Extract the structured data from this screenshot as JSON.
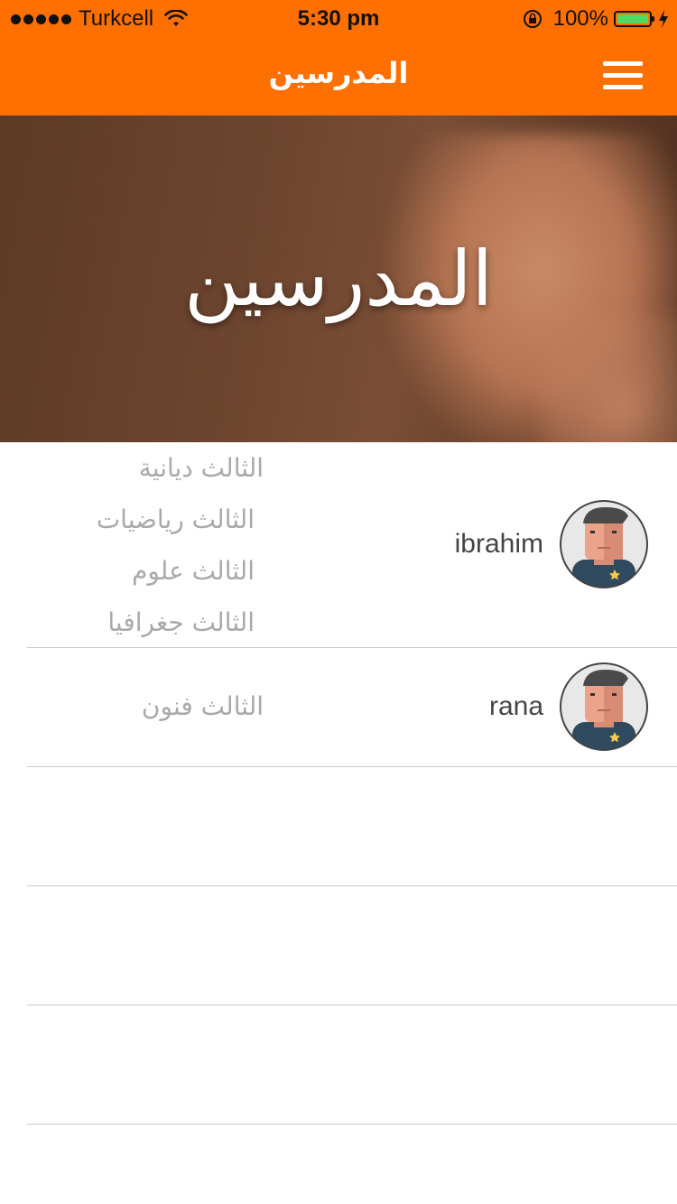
{
  "status_bar": {
    "carrier": "Turkcell",
    "time": "5:30 pm",
    "battery_percent": "100%",
    "battery_level": 1.0
  },
  "nav": {
    "title": "المدرسين",
    "menu_icon": "hamburger-menu-icon"
  },
  "hero": {
    "title": "المدرسين"
  },
  "teachers": [
    {
      "name": "ibrahim",
      "classes": [
        "الثالث ديانية",
        "الثالث رياضيات",
        "الثالث علوم",
        "الثالث جغرافيا"
      ]
    },
    {
      "name": "rana",
      "classes": [
        "الثالث فنون"
      ]
    }
  ],
  "colors": {
    "accent": "#ff7000",
    "divider": "#c8c7cc",
    "muted_text": "#a9a9a9"
  }
}
